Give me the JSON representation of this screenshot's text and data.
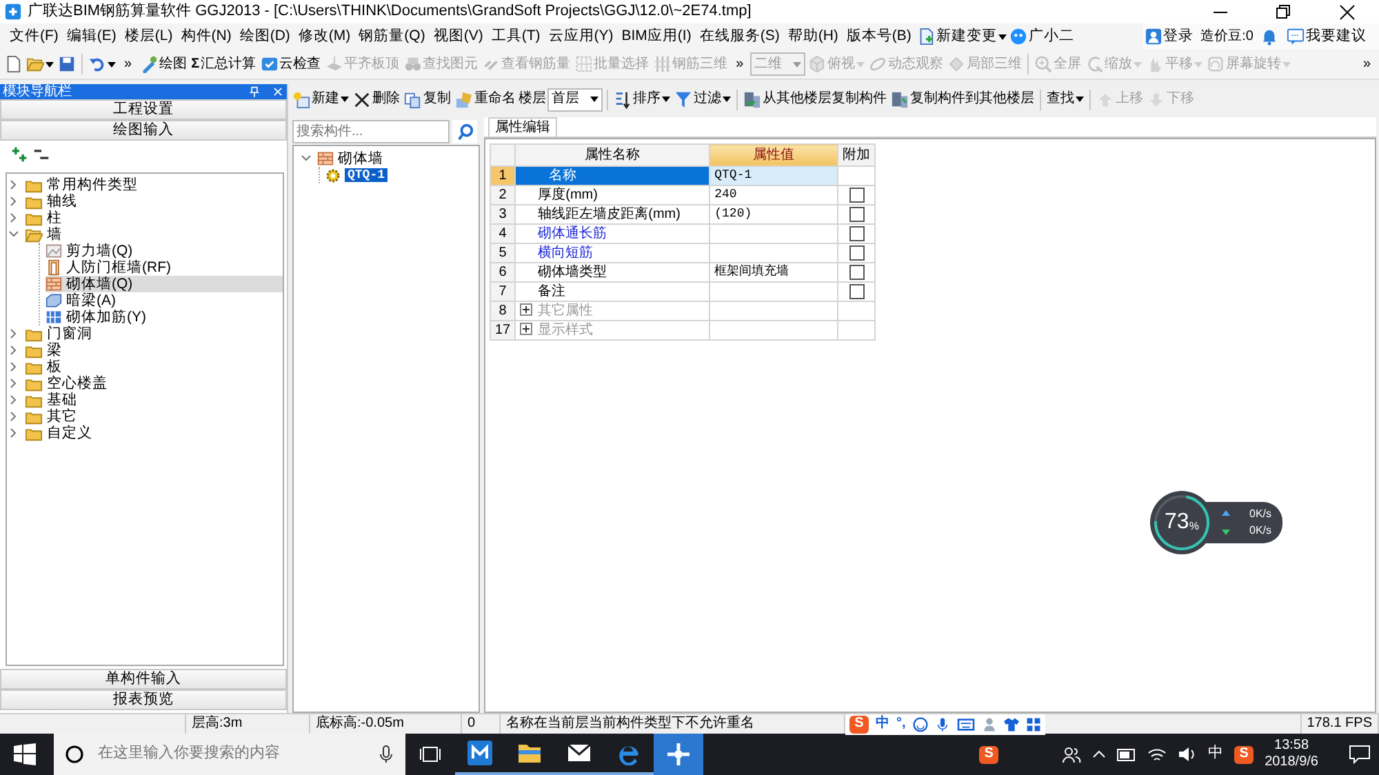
{
  "window": {
    "title": "广联达BIM钢筋算量软件 GGJ2013 - [C:\\Users\\THINK\\Documents\\GrandSoft Projects\\GGJ\\12.0\\~2E74.tmp]"
  },
  "menu": [
    "文件(F)",
    "编辑(E)",
    "楼层(L)",
    "构件(N)",
    "绘图(D)",
    "修改(M)",
    "钢筋量(Q)",
    "视图(V)",
    "工具(T)",
    "云应用(Y)",
    "BIM应用(I)",
    "在线服务(S)",
    "帮助(H)",
    "版本号(B)"
  ],
  "menu_extra": [
    {
      "label": "新建变更",
      "dropdown": true
    },
    {
      "label": "广小二",
      "dropdown": false
    }
  ],
  "account": {
    "login": "登录",
    "beans": "造价豆:0",
    "feedback": "我要建议"
  },
  "toolbar": [
    {
      "kind": "icon",
      "disabled": false,
      "dropdown": false
    },
    {
      "kind": "icon",
      "disabled": false,
      "dropdown": true
    },
    {
      "kind": "icon",
      "disabled": false,
      "dropdown": false
    },
    {
      "kind": "separator"
    },
    {
      "kind": "icon",
      "disabled": false,
      "dropdown": true
    },
    {
      "kind": "overflow",
      "label": "»"
    },
    {
      "kind": "button",
      "label": "绘图",
      "disabled": false,
      "dropdown": false
    },
    {
      "kind": "glyph",
      "glyph": "Σ",
      "label": "汇总计算",
      "disabled": false,
      "dropdown": false
    },
    {
      "kind": "button",
      "label": "云检查",
      "disabled": false,
      "dropdown": false
    },
    {
      "kind": "button",
      "label": "平齐板顶",
      "disabled": true,
      "dropdown": false
    },
    {
      "kind": "button",
      "label": "查找图元",
      "disabled": true,
      "dropdown": false
    },
    {
      "kind": "button",
      "label": "查看钢筋量",
      "disabled": true,
      "dropdown": false
    },
    {
      "kind": "button",
      "label": "批量选择",
      "disabled": true,
      "dropdown": false
    },
    {
      "kind": "button",
      "label": "钢筋三维",
      "disabled": true,
      "dropdown": false
    },
    {
      "kind": "overflow",
      "label": "»"
    },
    {
      "kind": "select",
      "label": "二维",
      "disabled": true
    },
    {
      "kind": "button",
      "label": "俯视",
      "disabled": true,
      "dropdown": true
    },
    {
      "kind": "button",
      "label": "动态观察",
      "disabled": true,
      "dropdown": false
    },
    {
      "kind": "button",
      "label": "局部三维",
      "disabled": true,
      "dropdown": false
    },
    {
      "kind": "separator"
    },
    {
      "kind": "button",
      "label": "全屏",
      "disabled": true,
      "dropdown": false
    },
    {
      "kind": "button",
      "label": "缩放",
      "disabled": true,
      "dropdown": true
    },
    {
      "kind": "button",
      "label": "平移",
      "disabled": true,
      "dropdown": true
    },
    {
      "kind": "button",
      "label": "屏幕旋转",
      "disabled": true,
      "dropdown": true
    },
    {
      "kind": "overflow-end",
      "label": "»"
    }
  ],
  "navigator": {
    "title": "模块导航栏",
    "sections": [
      "工程设置",
      "绘图输入"
    ],
    "tree": [
      {
        "label": "常用构件类型",
        "expanded": false
      },
      {
        "label": "轴线",
        "expanded": false
      },
      {
        "label": "柱",
        "expanded": false
      },
      {
        "label": "墙",
        "expanded": true,
        "children": [
          {
            "label": "剪力墙(Q)",
            "selected": false
          },
          {
            "label": "人防门框墙(RF)",
            "selected": false
          },
          {
            "label": "砌体墙(Q)",
            "selected": true
          },
          {
            "label": "暗梁(A)",
            "selected": false
          },
          {
            "label": "砌体加筋(Y)",
            "selected": false
          }
        ]
      },
      {
        "label": "门窗洞",
        "expanded": false
      },
      {
        "label": "梁",
        "expanded": false
      },
      {
        "label": "板",
        "expanded": false
      },
      {
        "label": "空心楼盖",
        "expanded": false
      },
      {
        "label": "基础",
        "expanded": false
      },
      {
        "label": "其它",
        "expanded": false
      },
      {
        "label": "自定义",
        "expanded": false
      }
    ],
    "bottom": [
      "单构件输入",
      "报表预览"
    ]
  },
  "component_toolbar": [
    {
      "kind": "button",
      "label": "新建",
      "disabled": false,
      "dropdown": true
    },
    {
      "kind": "button",
      "label": "删除",
      "disabled": false,
      "dropdown": false
    },
    {
      "kind": "button",
      "label": "复制",
      "disabled": false,
      "dropdown": false
    },
    {
      "kind": "button",
      "label": "重命名",
      "disabled": false,
      "dropdown": false
    },
    {
      "kind": "label",
      "label": "楼层"
    },
    {
      "kind": "select",
      "label": "首层",
      "disabled": false
    },
    {
      "kind": "separator"
    },
    {
      "kind": "button",
      "label": "排序",
      "disabled": false,
      "dropdown": true
    },
    {
      "kind": "button",
      "label": "过滤",
      "disabled": false,
      "dropdown": true
    },
    {
      "kind": "separator"
    },
    {
      "kind": "button",
      "label": "从其他楼层复制构件",
      "disabled": false,
      "dropdown": false
    },
    {
      "kind": "button",
      "label": "复制构件到其他楼层",
      "disabled": false,
      "dropdown": false
    },
    {
      "kind": "separator"
    },
    {
      "kind": "text-button",
      "label": "查找",
      "disabled": false,
      "dropdown": true
    },
    {
      "kind": "separator"
    },
    {
      "kind": "button",
      "label": "上移",
      "disabled": true,
      "dropdown": false
    },
    {
      "kind": "button",
      "label": "下移",
      "disabled": true,
      "dropdown": false
    }
  ],
  "component_list": {
    "search": {
      "placeholder": "搜索构件..."
    },
    "tree": [
      {
        "label": "砌体墙",
        "expanded": true,
        "children": [
          {
            "label": "QTQ-1",
            "selected": true
          }
        ]
      }
    ]
  },
  "properties": {
    "tabs": [
      {
        "label": "属性编辑",
        "selected": true
      }
    ],
    "columns": [
      "属性名称",
      "属性值",
      "附加"
    ],
    "rows": [
      {
        "num": "1",
        "kind": "plain",
        "name": "名称",
        "value": "QTQ-1",
        "selected": true
      },
      {
        "num": "2",
        "kind": "property",
        "name": "厚度(mm)",
        "value": "240",
        "selected": false,
        "checked": false
      },
      {
        "num": "3",
        "kind": "property",
        "name": "轴线距左墙皮距离(mm)",
        "value": "(120)",
        "selected": false,
        "checked": false
      },
      {
        "num": "4",
        "kind": "link",
        "name": "砌体通长筋",
        "selected": false,
        "checked": false
      },
      {
        "num": "5",
        "kind": "link",
        "name": "横向短筋",
        "selected": false,
        "checked": false
      },
      {
        "num": "6",
        "kind": "property",
        "name": "砌体墙类型",
        "value": "框架间填充墙",
        "selected": false,
        "checked": false
      },
      {
        "num": "7",
        "kind": "property",
        "name": "备注",
        "selected": false,
        "checked": false
      },
      {
        "num": "8",
        "kind": "group",
        "name": "其它属性",
        "selected": false,
        "expanded": false
      },
      {
        "num": "17",
        "kind": "group",
        "name": "显示样式",
        "selected": false,
        "expanded": false
      }
    ]
  },
  "net_monitor": {
    "percent": "73",
    "unit": "%",
    "level": 0.73,
    "upload": "0K/s",
    "download": "0K/s"
  },
  "status_bar": {
    "cells": [
      "层高:3m",
      "底标高:-0.05m",
      "0",
      "名称在当前层当前构件类型下不允许重名"
    ],
    "ime": {
      "logo": "S",
      "texts": [
        "中",
        "°,"
      ]
    },
    "fps": "178.1 FPS"
  },
  "taskbar": {
    "search": {
      "placeholder": "在这里输入你要搜索的内容"
    },
    "apps": [
      {
        "selected": false
      },
      {
        "selected": false
      },
      {
        "selected": false
      },
      {
        "selected": false
      },
      {
        "selected": true
      }
    ],
    "tray_logo": "S",
    "ime": "中",
    "ime_logo": "S",
    "time": "13:58",
    "date": "2018/9/6"
  }
}
